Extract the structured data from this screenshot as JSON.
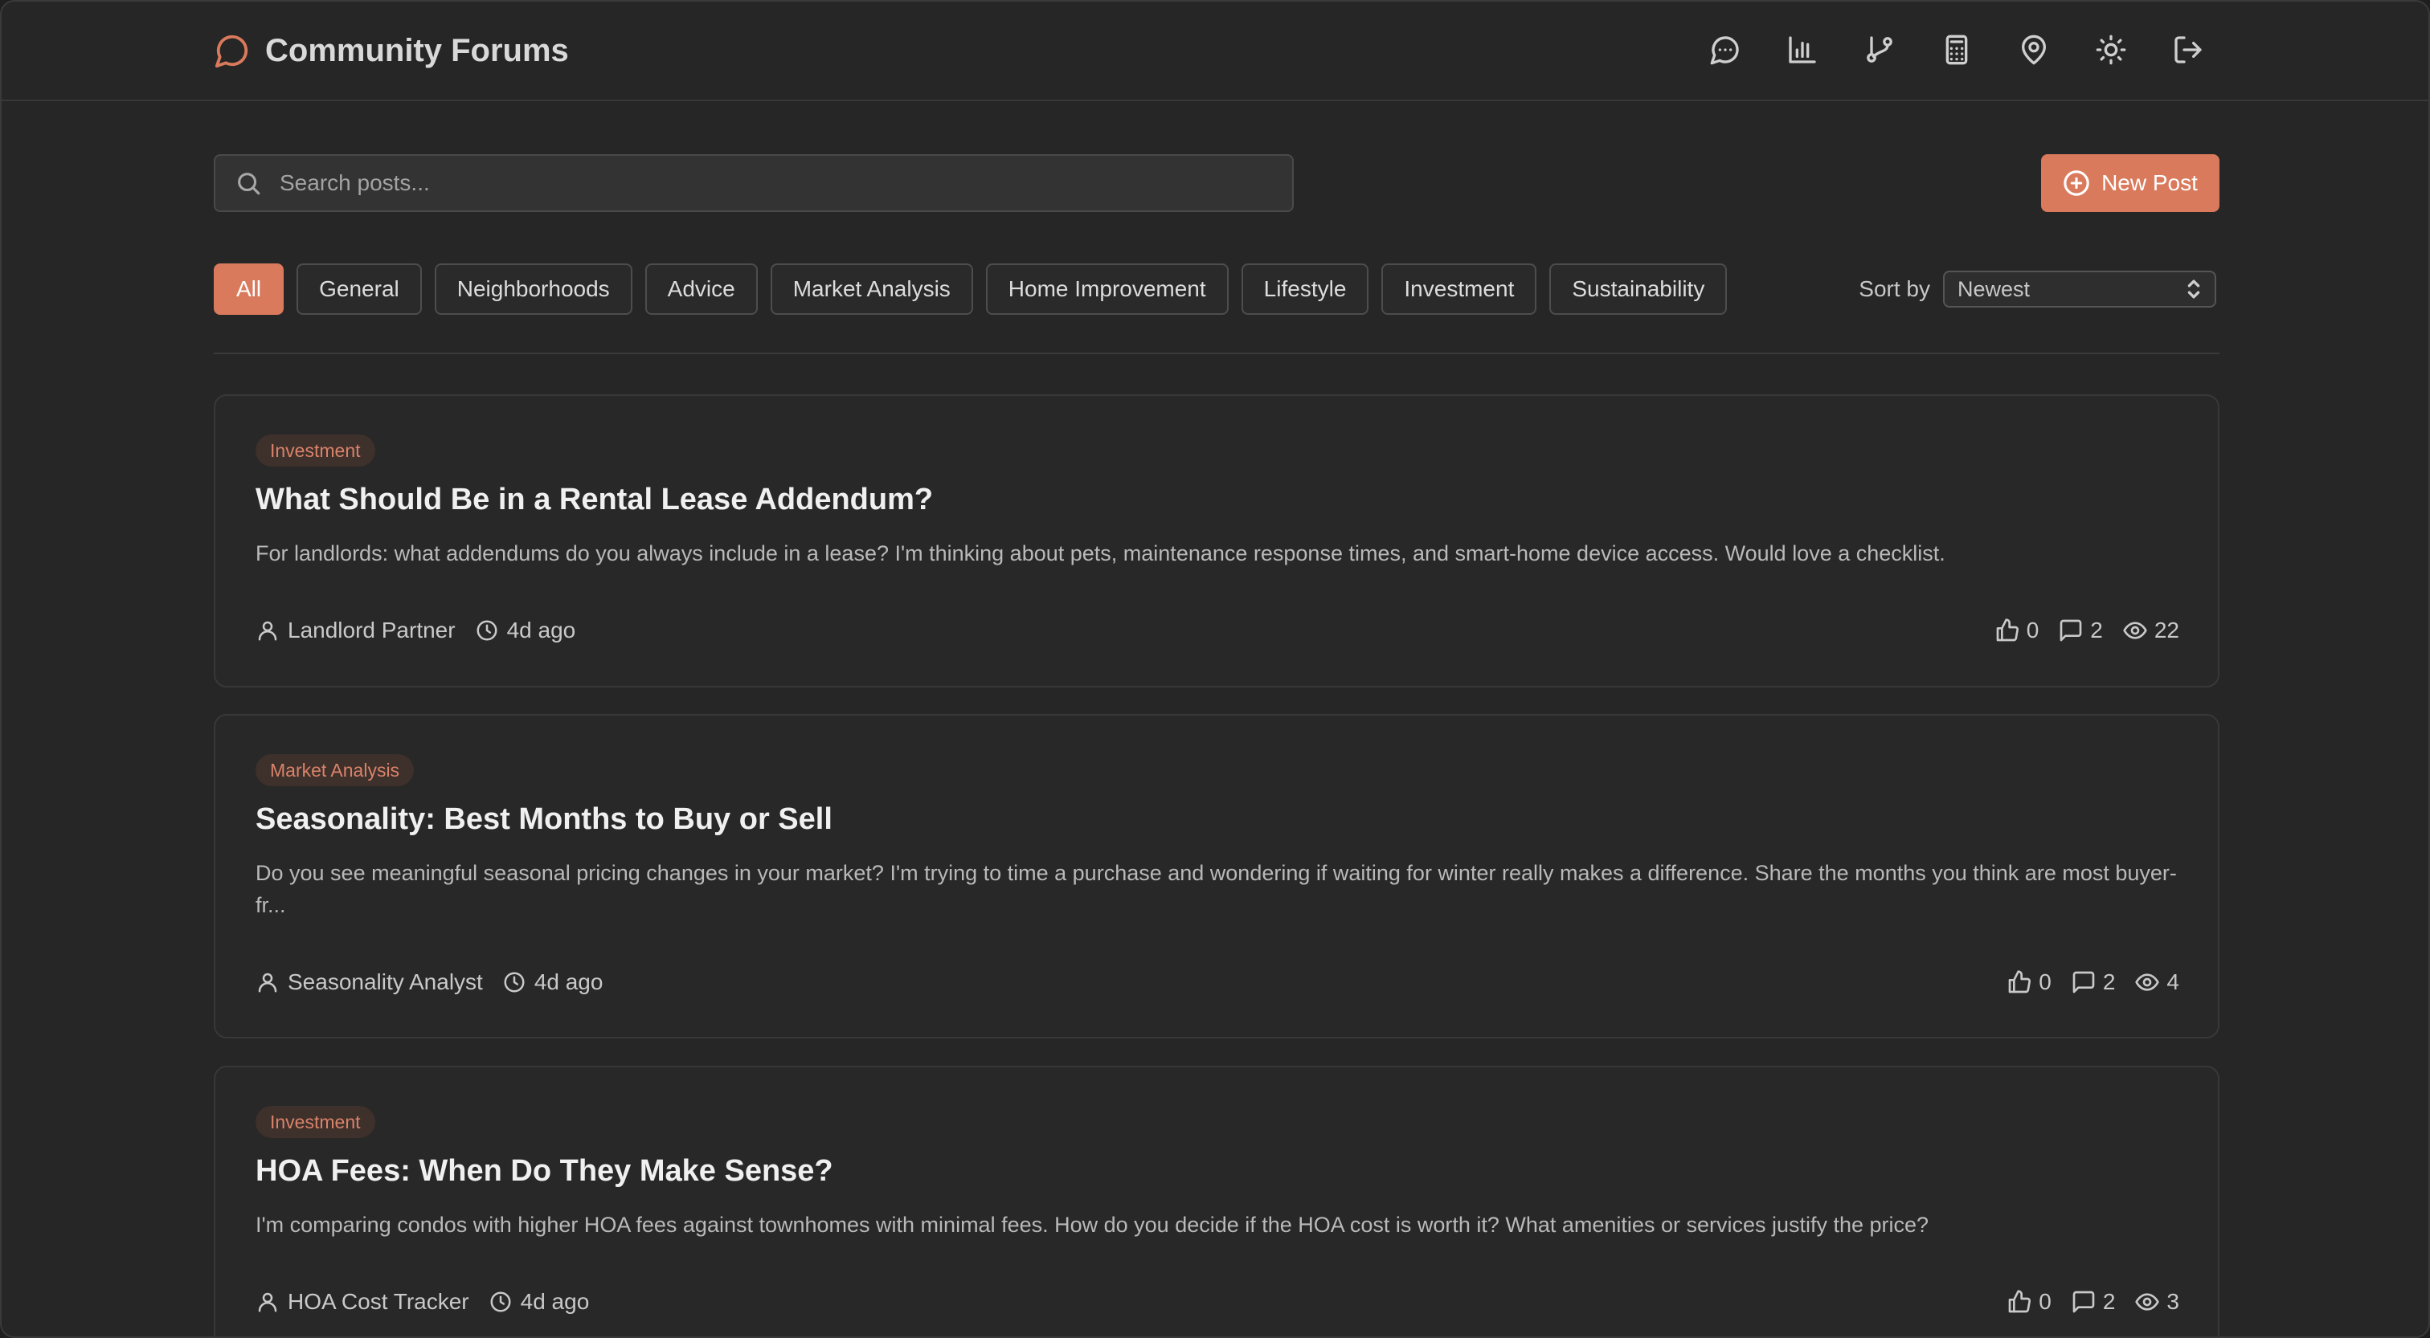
{
  "app": {
    "title": "Community Forums"
  },
  "colors": {
    "accent": "#d97a5c",
    "background": "#262626",
    "card": "#282828"
  },
  "nav": {
    "icons": [
      "chat-icon",
      "bar-chart-icon",
      "git-branch-icon",
      "calculator-icon",
      "map-pin-icon",
      "sun-icon",
      "logout-icon"
    ]
  },
  "search": {
    "placeholder": "Search posts...",
    "value": ""
  },
  "actions": {
    "new_post": "New Post"
  },
  "filters": [
    "All",
    "General",
    "Neighborhoods",
    "Advice",
    "Market Analysis",
    "Home Improvement",
    "Lifestyle",
    "Investment",
    "Sustainability"
  ],
  "active_filter": "All",
  "sort": {
    "label": "Sort by",
    "selected": "Newest"
  },
  "posts": [
    {
      "category": "Investment",
      "title": "What Should Be in a Rental Lease Addendum?",
      "body": "For landlords: what addendums do you always include in a lease? I'm thinking about pets, maintenance response times, and smart-home device access. Would love a checklist.",
      "author": "Landlord Partner",
      "time": "4d ago",
      "likes": "0",
      "comments": "2",
      "views": "22"
    },
    {
      "category": "Market Analysis",
      "title": "Seasonality: Best Months to Buy or Sell",
      "body": "Do you see meaningful seasonal pricing changes in your market? I'm trying to time a purchase and wondering if waiting for winter really makes a difference. Share the months you think are most buyer-fr...",
      "author": "Seasonality Analyst",
      "time": "4d ago",
      "likes": "0",
      "comments": "2",
      "views": "4"
    },
    {
      "category": "Investment",
      "title": "HOA Fees: When Do They Make Sense?",
      "body": "I'm comparing condos with higher HOA fees against townhomes with minimal fees. How do you decide if the HOA cost is worth it? What amenities or services justify the price?",
      "author": "HOA Cost Tracker",
      "time": "4d ago",
      "likes": "0",
      "comments": "2",
      "views": "3"
    }
  ]
}
